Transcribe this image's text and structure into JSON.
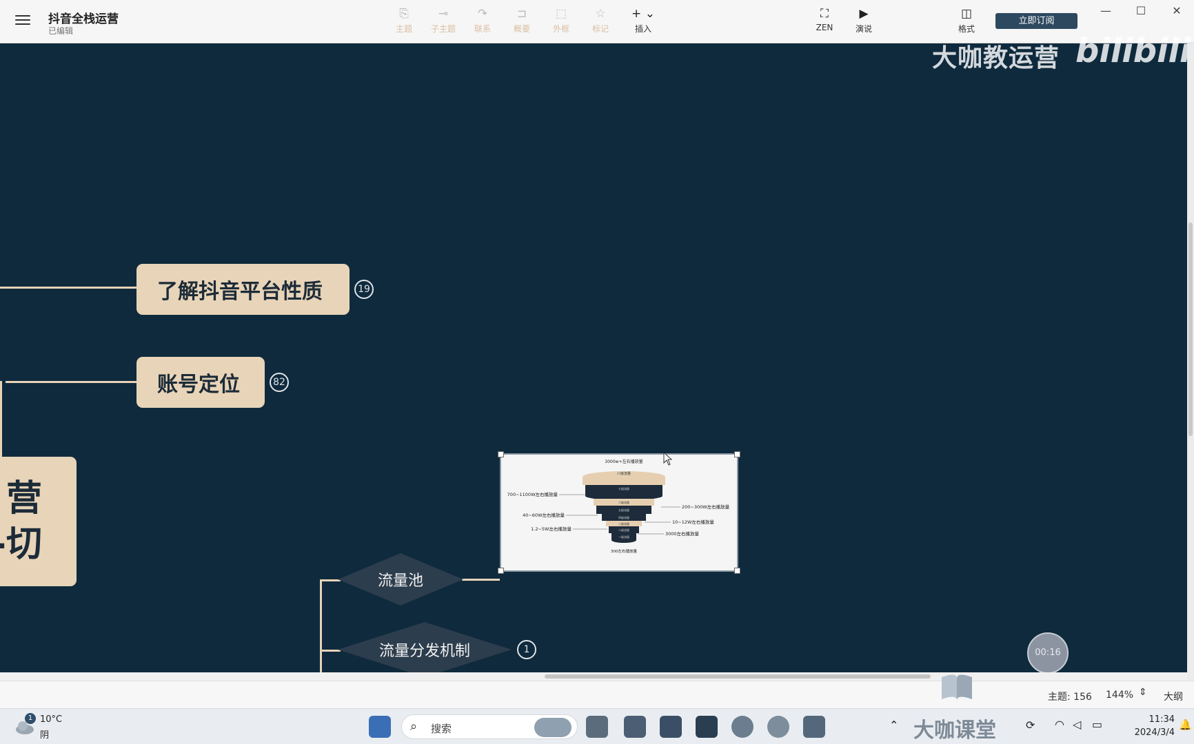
{
  "titlebar": {
    "title": "抖音全栈运营",
    "status": "已编辑",
    "tools": [
      {
        "label": "主题",
        "icon": "topic-icon",
        "glyph": "⎘"
      },
      {
        "label": "子主题",
        "icon": "subtopic-icon",
        "glyph": "⊸"
      },
      {
        "label": "联系",
        "icon": "relationship-icon",
        "glyph": "↷"
      },
      {
        "label": "概要",
        "icon": "summary-icon",
        "glyph": "⊐"
      },
      {
        "label": "外框",
        "icon": "boundary-icon",
        "glyph": "⬚"
      },
      {
        "label": "标记",
        "icon": "marker-icon",
        "glyph": "☆"
      },
      {
        "label": "插入",
        "icon": "insert-icon",
        "glyph": "+ ⌄"
      },
      {
        "label": "ZEN",
        "icon": "zen-mode-icon",
        "glyph": "⛶"
      },
      {
        "label": "演说",
        "icon": "pitch-icon",
        "glyph": "▶"
      },
      {
        "label": "格式",
        "icon": "format-panel-icon",
        "glyph": "◫"
      }
    ],
    "subscribe_label": "立即订阅",
    "window_controls": [
      "—",
      "☐",
      "✕"
    ]
  },
  "watermark": {
    "text": "大咖教运营",
    "logo": "bilibili"
  },
  "mindmap": {
    "root_partial": {
      "line1": "营",
      "line2": "-切"
    },
    "topics": [
      {
        "label": "了解抖音平台性质",
        "count": "19"
      },
      {
        "label": "账号定位",
        "count": "82"
      }
    ],
    "subtopics": [
      {
        "label": "流量池"
      },
      {
        "label": "流量分发机制",
        "count": "1"
      }
    ],
    "image": {
      "top_label": "3000w+左右播放量",
      "left_labels": [
        "700~1100W左右播放量",
        "40~60W左右播放量",
        "1.2~5W左右播放量"
      ],
      "right_labels": [
        "200~300W左右播放量",
        "10~12W左右播放量",
        "3000左右播放量"
      ],
      "bottom_label": "300左右播放量",
      "tier_labels": [
        "八级流量",
        "七级流量",
        "六级流量",
        "五级流量",
        "四级流量",
        "三级流量",
        "二级流量",
        "一级流量"
      ]
    }
  },
  "timer": "00:16",
  "statusbar": {
    "topic_count": "主题: 156",
    "zoom": "144%",
    "outline": "大纲"
  },
  "taskbar": {
    "weather_temp": "10°C",
    "weather_desc": "阴",
    "weather_badge": "1",
    "search_placeholder": "搜索",
    "time": "11:34",
    "date": "2024/3/4",
    "overlay_text": "大咖课堂"
  }
}
